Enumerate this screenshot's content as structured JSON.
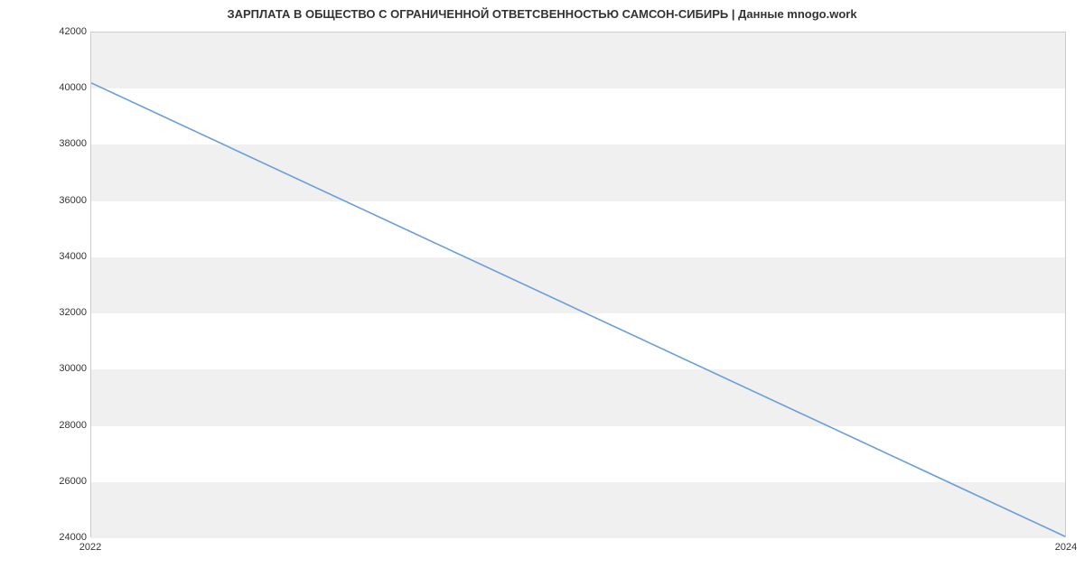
{
  "chart_data": {
    "type": "line",
    "title": "ЗАРПЛАТА В ОБЩЕСТВО С ОГРАНИЧЕННОЙ ОТВЕТСВЕННОСТЬЮ САМСОН-СИБИРЬ | Данные mnogo.work",
    "x": [
      2022,
      2024
    ],
    "values": [
      40200,
      24000
    ],
    "xlabel": "",
    "ylabel": "",
    "xticks": [
      2022,
      2024
    ],
    "yticks": [
      24000,
      26000,
      28000,
      30000,
      32000,
      34000,
      36000,
      38000,
      40000,
      42000
    ],
    "xlim": [
      2022,
      2024
    ],
    "ylim": [
      24000,
      42000
    ],
    "line_color": "#6a9ed8",
    "band_color": "#f0f0f0"
  }
}
